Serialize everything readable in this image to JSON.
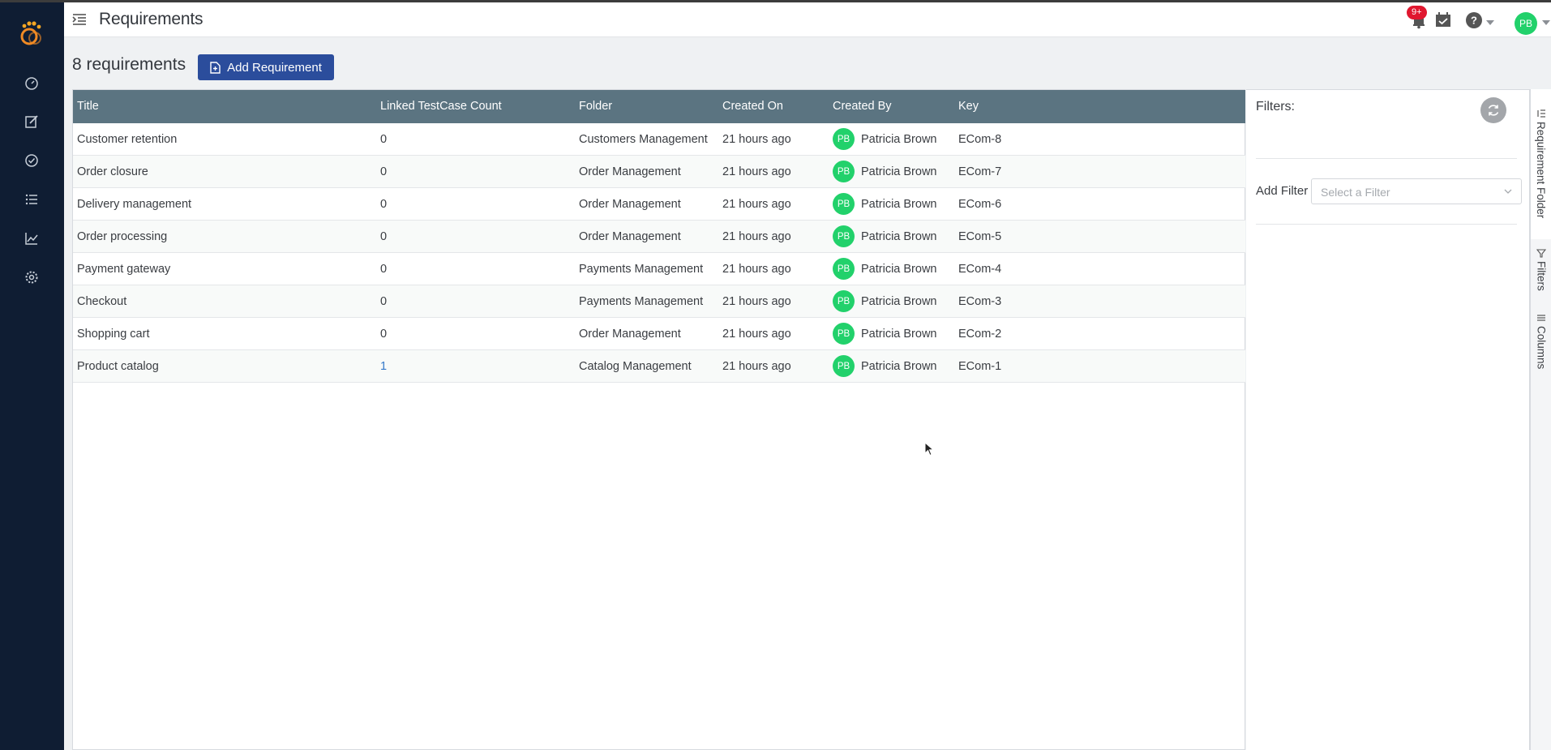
{
  "header": {
    "title": "Requirements",
    "notification_count": "9+",
    "user_initials": "PB"
  },
  "sidebar": {
    "items": [
      {
        "name": "dashboard",
        "icon": "speedometer-icon"
      },
      {
        "name": "requirements",
        "icon": "edit-icon"
      },
      {
        "name": "test-cases",
        "icon": "check-circle-icon"
      },
      {
        "name": "test-runs",
        "icon": "list-icon"
      },
      {
        "name": "reports",
        "icon": "chart-line-icon"
      },
      {
        "name": "settings",
        "icon": "gear-icon"
      }
    ]
  },
  "toolbar": {
    "count_label": "8 requirements",
    "add_button_label": "Add Requirement"
  },
  "table": {
    "columns": [
      "Title",
      "Linked TestCase Count",
      "Folder",
      "Created On",
      "Created By",
      "Key"
    ],
    "rows": [
      {
        "title": "Customer retention",
        "linked": "0",
        "folder": "Customers Management",
        "created_on": "21 hours ago",
        "initials": "PB",
        "created_by": "Patricia Brown",
        "key": "ECom-8"
      },
      {
        "title": "Order closure",
        "linked": "0",
        "folder": "Order Management",
        "created_on": "21 hours ago",
        "initials": "PB",
        "created_by": "Patricia Brown",
        "key": "ECom-7"
      },
      {
        "title": "Delivery management",
        "linked": "0",
        "folder": "Order Management",
        "created_on": "21 hours ago",
        "initials": "PB",
        "created_by": "Patricia Brown",
        "key": "ECom-6"
      },
      {
        "title": "Order processing",
        "linked": "0",
        "folder": "Order Management",
        "created_on": "21 hours ago",
        "initials": "PB",
        "created_by": "Patricia Brown",
        "key": "ECom-5"
      },
      {
        "title": "Payment gateway",
        "linked": "0",
        "folder": "Payments Management",
        "created_on": "21 hours ago",
        "initials": "PB",
        "created_by": "Patricia Brown",
        "key": "ECom-4"
      },
      {
        "title": "Checkout",
        "linked": "0",
        "folder": "Payments Management",
        "created_on": "21 hours ago",
        "initials": "PB",
        "created_by": "Patricia Brown",
        "key": "ECom-3"
      },
      {
        "title": "Shopping cart",
        "linked": "0",
        "folder": "Order Management",
        "created_on": "21 hours ago",
        "initials": "PB",
        "created_by": "Patricia Brown",
        "key": "ECom-2"
      },
      {
        "title": "Product catalog",
        "linked": "1",
        "folder": "Catalog Management",
        "created_on": "21 hours ago",
        "initials": "PB",
        "created_by": "Patricia Brown",
        "key": "ECom-1"
      }
    ]
  },
  "filters": {
    "title": "Filters:",
    "add_filter_label": "Add Filter",
    "select_placeholder": "Select a Filter"
  },
  "side_tabs": [
    "Requirement Folder",
    "Filters",
    "Columns"
  ],
  "colors": {
    "sidebar": "#0f1d33",
    "header_row": "#5b7481",
    "primary_button": "#2b4d9c",
    "avatar": "#22d16b",
    "badge": "#e0172f",
    "link": "#3579c9"
  }
}
